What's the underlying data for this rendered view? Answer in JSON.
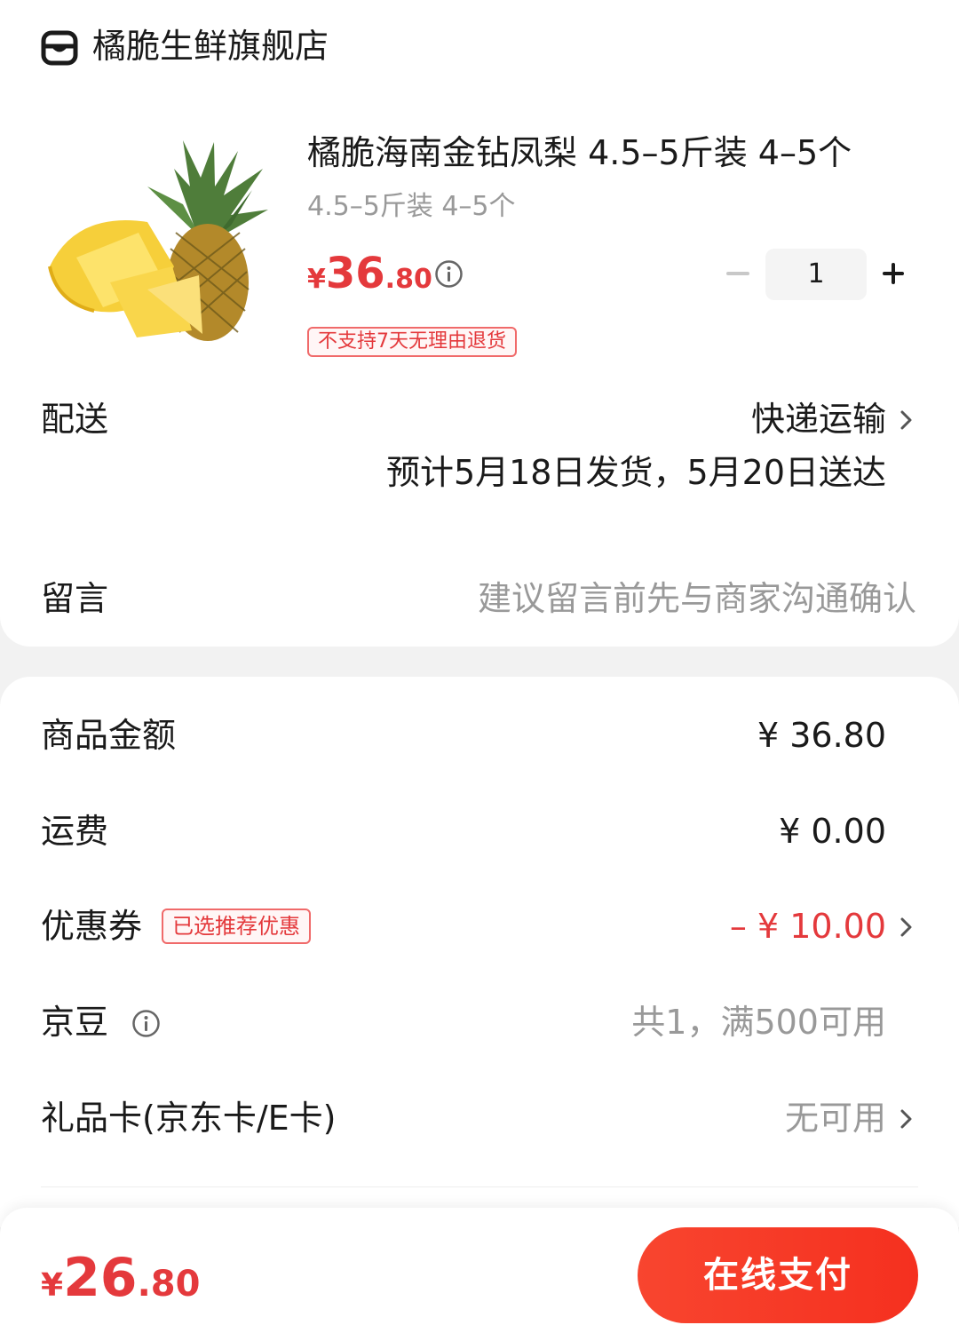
{
  "store": {
    "icon": "store-icon",
    "name": "橘脆生鲜旗舰店"
  },
  "product": {
    "image": "pineapple-image",
    "title": "橘脆海南金钻凤梨 4.5–5斤装 4–5个",
    "spec": "4.5–5斤装 4–5个",
    "price": {
      "currency": "¥",
      "integer": "36",
      "decimal": ".80"
    },
    "quantity": "1",
    "tag": "不支持7天无理由退货"
  },
  "delivery": {
    "label": "配送",
    "method": "快递运输",
    "estimate": "预计5月18日发货，5月20日送达"
  },
  "message": {
    "label": "留言",
    "placeholder": "建议留言前先与商家沟通确认"
  },
  "summary": {
    "goods_amount": {
      "label": "商品金额",
      "value": "¥ 36.80"
    },
    "shipping": {
      "label": "运费",
      "value": "¥ 0.00"
    },
    "coupon": {
      "label": "优惠券",
      "tag": "已选推荐优惠",
      "value": "– ¥ 10.00"
    },
    "jd_beans": {
      "label": "京豆",
      "value": "共1，满500可用"
    },
    "gift_card": {
      "label": "礼品卡(京东卡/E卡)",
      "value": "无可用"
    }
  },
  "footer": {
    "total": {
      "currency": "¥",
      "integer": "26",
      "decimal": ".80"
    },
    "pay_button": "在线支付"
  },
  "colors": {
    "accent_red": "#e4393c",
    "pay_button": "#f5301f",
    "muted_text": "#999999"
  }
}
